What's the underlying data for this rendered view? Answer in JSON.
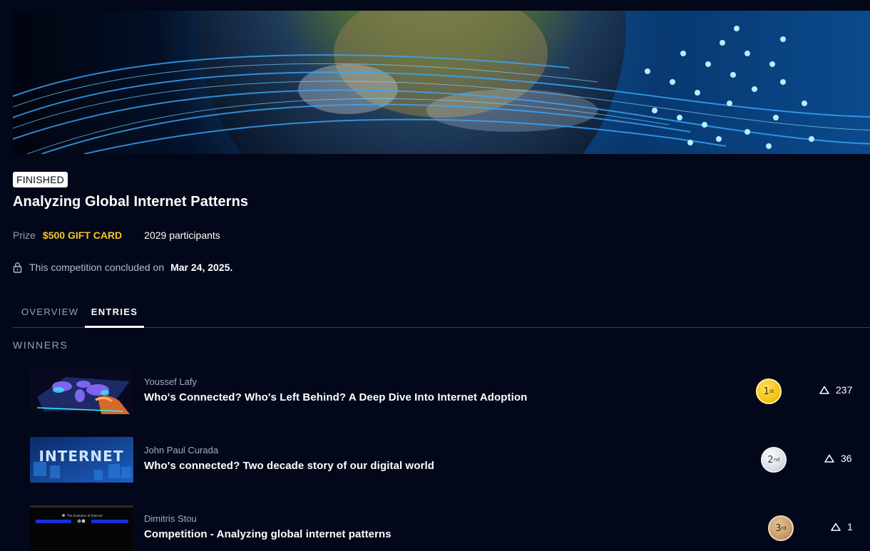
{
  "competition": {
    "status": "FINISHED",
    "title": "Analyzing Global Internet Patterns",
    "prize_label": "Prize",
    "prize_value": "$500 GIFT CARD",
    "participants": "2029 participants",
    "concluded_text": "This competition concluded on",
    "concluded_date": "Mar 24, 2025."
  },
  "tabs": [
    {
      "label": "OVERVIEW",
      "active": false
    },
    {
      "label": "ENTRIES",
      "active": true
    }
  ],
  "section_title": "WINNERS",
  "entries": [
    {
      "author": "Youssef Lafy",
      "title": "Who's Connected? Who's Left Behind? A Deep Dive Into Internet Adoption",
      "place": "1",
      "place_suffix": "st",
      "votes": "237"
    },
    {
      "author": "John Paul Curada",
      "title": "Who's connected? Two decade story of our digital world",
      "place": "2",
      "place_suffix": "nd",
      "votes": "36"
    },
    {
      "author": "Dimitris Stou",
      "title": "Competition - Analyzing global internet patterns",
      "place": "3",
      "place_suffix": "rd",
      "votes": "1"
    }
  ],
  "thumbnail_text": {
    "internet": "INTERNET",
    "evolution": "The Evolution of Internet"
  },
  "colors": {
    "background": "#020819",
    "prize": "#f7c52b",
    "gold": "#f4c20d",
    "silver": "#d8dbe2",
    "bronze": "#c49a66"
  },
  "icons": {
    "lock": "lock-icon",
    "upvote": "triangle-up-icon"
  }
}
